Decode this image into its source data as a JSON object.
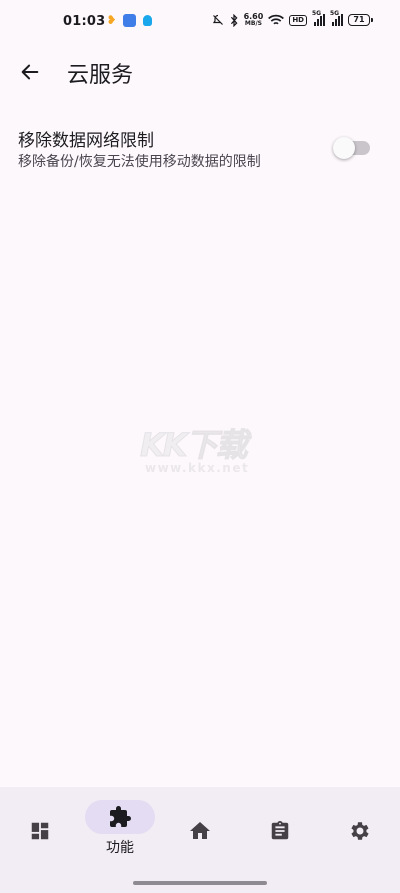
{
  "status_bar": {
    "time": "01:03",
    "notification_icons": [
      "heart-icon",
      "app-icon",
      "qq-icon"
    ],
    "net_speed_value": "6.60",
    "net_speed_unit": "MB/S",
    "hd_label": "HD",
    "sim1_label": "5G",
    "sim2_label": "5G",
    "battery_level": "71"
  },
  "app_bar": {
    "title": "云服务"
  },
  "setting": {
    "title": "移除数据网络限制",
    "description": "移除备份/恢复无法使用移动数据的限制",
    "enabled": false
  },
  "watermark": {
    "main": "KK下载",
    "sub": "www.kkx.net"
  },
  "bottom_nav": {
    "items": [
      {
        "icon": "dashboard-icon",
        "label": ""
      },
      {
        "icon": "extension-icon",
        "label": "功能",
        "active": true
      },
      {
        "icon": "home-icon",
        "label": ""
      },
      {
        "icon": "clipboard-icon",
        "label": ""
      },
      {
        "icon": "gear-icon",
        "label": ""
      }
    ]
  },
  "colors": {
    "background": "#fdf8fc",
    "nav_background": "#f2ecf4",
    "active_pill": "#e4dcf2",
    "text_primary": "#1c1b1f",
    "text_secondary": "#49454f"
  }
}
